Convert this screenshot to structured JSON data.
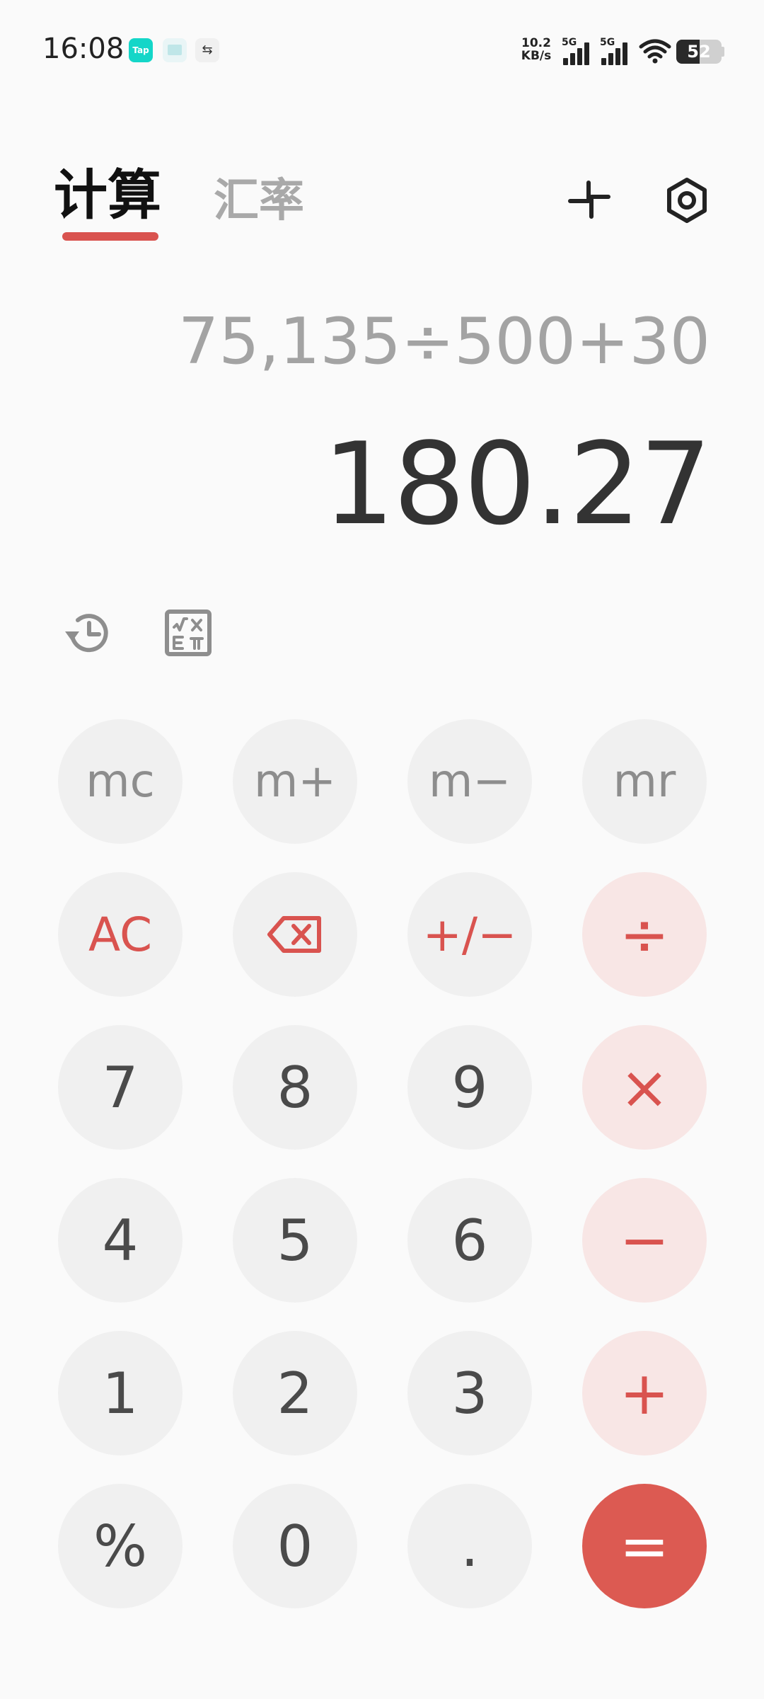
{
  "status_bar": {
    "time": "16:08",
    "net_speed_value": "10.2",
    "net_speed_unit": "KB/s",
    "sim1_label": "5G",
    "sim2_label": "5G",
    "battery_level": "52",
    "notification_icons": [
      "taptap-icon",
      "files-icon",
      "link-icon"
    ],
    "tap_icon_label": "Tap"
  },
  "header": {
    "tab_calculator": "计算",
    "tab_exchange_rate": "汇率",
    "accent_color": "#d9534f"
  },
  "display": {
    "expression": "75,135÷500+30",
    "result": "180.27"
  },
  "keys": {
    "mc": "mc",
    "m_plus": "m+",
    "m_minus": "m−",
    "mr": "mr",
    "ac": "AC",
    "sign": "+/−",
    "divide": "÷",
    "multiply": "×",
    "subtract": "−",
    "add": "+",
    "equals": "=",
    "percent": "%",
    "decimal": ".",
    "d0": "0",
    "d1": "1",
    "d2": "2",
    "d3": "3",
    "d4": "4",
    "d5": "5",
    "d6": "6",
    "d7": "7",
    "d8": "8",
    "d9": "9"
  }
}
